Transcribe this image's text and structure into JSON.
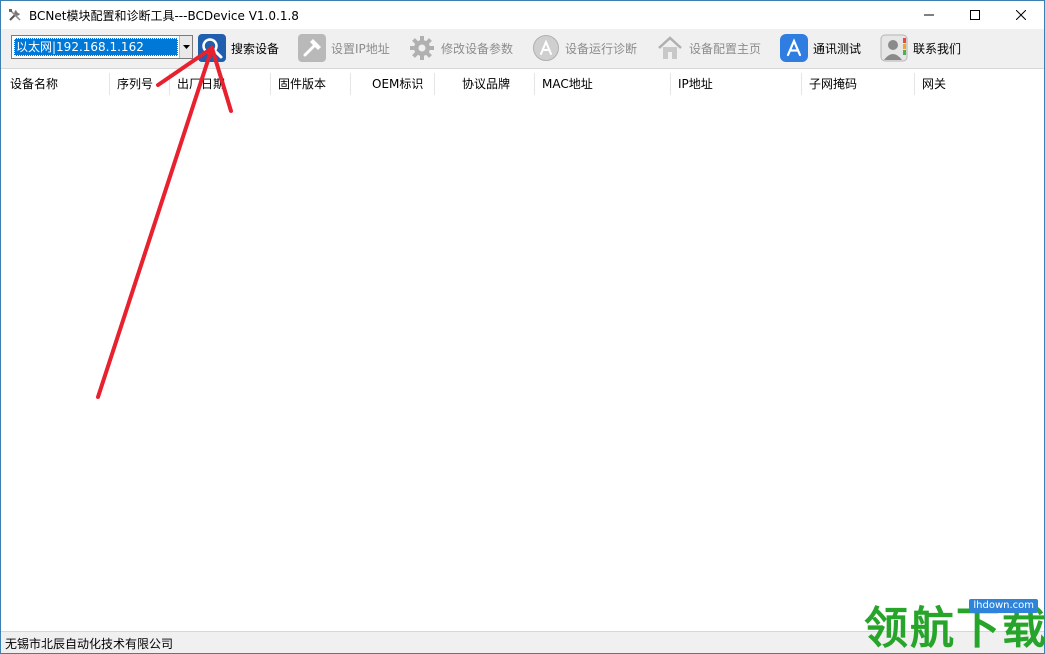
{
  "window": {
    "title": "BCNet模块配置和诊断工具---BCDevice V1.0.1.8",
    "icon": "tools-icon",
    "controls": [
      "minimize-icon",
      "maximize-icon",
      "close-icon"
    ]
  },
  "toolbar": {
    "interface_combo": {
      "value": "以太网|192.168.1.162"
    },
    "buttons": [
      {
        "label": "搜索设备",
        "icon": "search-icon",
        "enabled": true
      },
      {
        "label": "设置IP地址",
        "icon": "hammer-icon",
        "enabled": false
      },
      {
        "label": "修改设备参数",
        "icon": "gear-icon",
        "enabled": false
      },
      {
        "label": "设备运行诊断",
        "icon": "app-store-icon",
        "enabled": false
      },
      {
        "label": "设备配置主页",
        "icon": "home-icon",
        "enabled": false
      },
      {
        "label": "通讯测试",
        "icon": "app-store-icon",
        "enabled": true
      },
      {
        "label": "联系我们",
        "icon": "contact-icon",
        "enabled": true
      }
    ]
  },
  "table": {
    "columns": [
      "设备名称",
      "序列号",
      "出厂日期",
      "固件版本",
      "OEM标识",
      "协议品牌",
      "MAC地址",
      "IP地址",
      "子网掩码",
      "网关"
    ],
    "rows": []
  },
  "statusbar": {
    "text": "无锡市北辰自动化技术有限公司"
  },
  "watermark": {
    "text": "领航下载",
    "url": "lhdown.com"
  },
  "colors": {
    "selection": "#0078d7",
    "annotation_arrow": "#e8212e",
    "watermark_green": "#27a52a",
    "search_icon_bg": "#1f5fae"
  }
}
